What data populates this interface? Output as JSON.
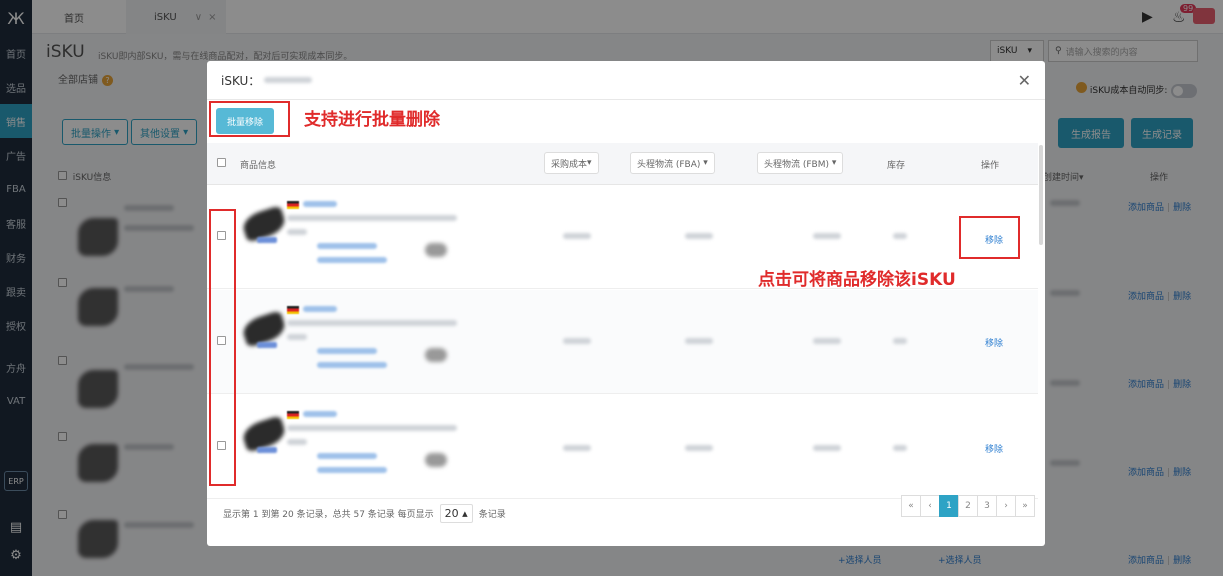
{
  "sidebar": {
    "logo": "Ж",
    "items": [
      {
        "label": "首页"
      },
      {
        "label": "选品"
      },
      {
        "label": "销售",
        "active": true
      },
      {
        "label": "广告"
      },
      {
        "label": "FBA"
      },
      {
        "label": "客服"
      },
      {
        "label": "财务"
      },
      {
        "label": "跟卖"
      },
      {
        "label": "授权"
      },
      {
        "label": "方舟"
      },
      {
        "label": "VAT"
      }
    ],
    "erp_label": "ERP",
    "accent": "#2ea3c5"
  },
  "topbar": {
    "tabs": [
      {
        "label": "首页"
      },
      {
        "label": "iSKU",
        "caret": "∨",
        "close": "×"
      }
    ],
    "notification_count": "99"
  },
  "page": {
    "title": "iSKU",
    "description": "iSKU即内部SKU，需与在线商品配对，配对后可实现成本同步。",
    "store_filter": "全部店铺",
    "search_type": "iSKU",
    "search_placeholder": "请输入搜索的内容",
    "auto_sync_label": "iSKU成本自动同步:",
    "bulk_ops": "批量操作",
    "other_settings": "其他设置",
    "generate_report": "生成报告",
    "generate_record": "生成记录",
    "col_info": "iSKU信息",
    "col_created": "创建时间",
    "col_action": "操作",
    "row_actions": {
      "add": "添加商品",
      "delete": "删除"
    },
    "bottom_links": [
      "+选择人员",
      "+选择人员"
    ]
  },
  "modal": {
    "title": "iSKU：",
    "bulk_remove": "批量移除",
    "columns": {
      "product_info": "商品信息",
      "purchase_cost": "采购成本",
      "first_leg_fba": "头程物流 (FBA)",
      "first_leg_fbm": "头程物流 (FBM)",
      "stock": "库存",
      "action": "操作"
    },
    "rows": [
      {
        "action": "移除"
      },
      {
        "action": "移除"
      },
      {
        "action": "移除"
      }
    ],
    "pagination": {
      "summary": "显示第 1 到第 20 条记录，总共 57 条记录 每页显示",
      "page_size": "20",
      "suffix": "条记录",
      "pages": [
        "«",
        "‹",
        "1",
        "2",
        "3",
        "›",
        "»"
      ],
      "current": "1"
    }
  },
  "annotations": {
    "bulk_delete": "支持进行批量删除",
    "remove_item": "点击可将商品移除该iSKU"
  }
}
